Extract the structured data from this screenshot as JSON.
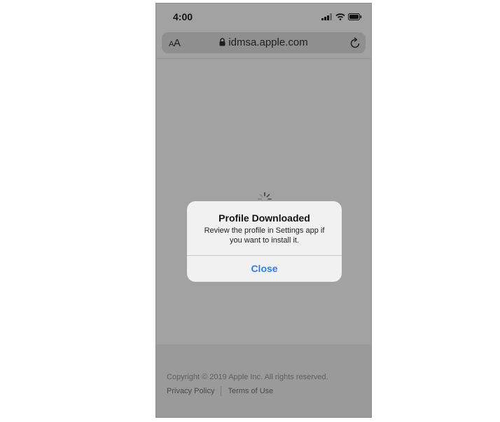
{
  "status_bar": {
    "time": "4:00",
    "icons": [
      "cellular-signal-icon",
      "wifi-icon",
      "battery-icon"
    ]
  },
  "browser": {
    "text_size_large": "A",
    "text_size_small": "A",
    "url": "idmsa.apple.com",
    "icons": [
      "lock-icon",
      "reload-icon"
    ]
  },
  "page": {
    "loading_icon": "spinner-icon",
    "footer": {
      "copyright": "Copyright © 2019 Apple Inc. All rights reserved.",
      "links": [
        "Privacy Policy",
        "Terms of Use"
      ]
    }
  },
  "alert": {
    "title": "Profile Downloaded",
    "message": "Review the profile in Settings app if you want to install it.",
    "button_label": "Close"
  },
  "colors": {
    "dimmed_background": "#a2a2a2",
    "alert_background": "#f1f1f1",
    "accent": "#2f7fe0"
  }
}
